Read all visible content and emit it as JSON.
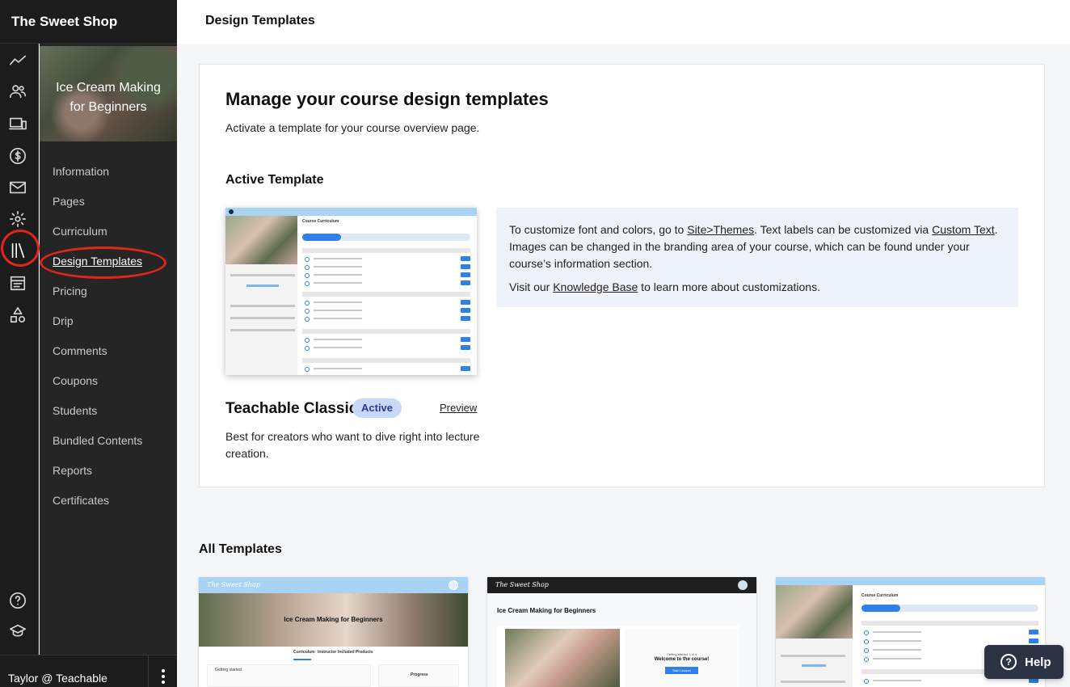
{
  "app": {
    "school_name": "The Sweet Shop",
    "page_title": "Design Templates"
  },
  "course": {
    "title": "Ice Cream Making for Beginners"
  },
  "sidebar": {
    "icons": [
      "chart-line-icon",
      "users-icon",
      "devices-icon",
      "dollar-icon",
      "mail-icon",
      "gear-icon",
      "library-icon",
      "calendar-icon",
      "shapes-icon"
    ],
    "bottom_icons": [
      "help-circle-icon",
      "graduation-cap-icon"
    ],
    "items": [
      {
        "label": "Information"
      },
      {
        "label": "Pages"
      },
      {
        "label": "Curriculum"
      },
      {
        "label": "Design Templates",
        "active": true
      },
      {
        "label": "Pricing"
      },
      {
        "label": "Drip"
      },
      {
        "label": "Comments"
      },
      {
        "label": "Coupons"
      },
      {
        "label": "Students"
      },
      {
        "label": "Bundled Contents"
      },
      {
        "label": "Reports"
      },
      {
        "label": "Certificates"
      }
    ]
  },
  "user": {
    "name": "Taylor @ Teachable"
  },
  "main": {
    "heading": "Manage your course design templates",
    "subheading": "Activate a template for your course overview page.",
    "active_section": "Active Template",
    "active_template": {
      "name": "Teachable Classic",
      "badge": "Active",
      "preview_label": "Preview",
      "description": "Best for creators who want to dive right into lecture creation."
    },
    "info": {
      "p1_a": "To customize font and colors, go to ",
      "p1_link1": "Site>Themes",
      "p1_b": ". Text labels can be customized via ",
      "p1_link2": "Custom Text",
      "p1_c": ". Images can be changed in the branding area of your course, which can be found under your course’s information section.",
      "p2_a": "Visit our ",
      "p2_link": "Knowledge Base",
      "p2_b": " to learn more about customizations."
    },
    "all_templates_heading": "All Templates"
  },
  "thumbs": {
    "curriculum": "Course Curriculum",
    "start_next": "Start next lecture",
    "shop_name": "The Sweet Shop",
    "course_title": "Ice Cream Making for Beginners",
    "tabs": [
      "Curriculum",
      "Instructor",
      "Included Products"
    ],
    "getting_started": "Getting started",
    "progress": "Progress",
    "welcome": "Welcome to the course!",
    "start_lesson": "Start Lesson",
    "getting_started_count": "Getting started 1 of 4"
  },
  "help": {
    "label": "Help"
  },
  "colors": {
    "accent": "#2f80ed",
    "highlight_ring": "#e1251b",
    "badge_bg": "#c9d8f9"
  }
}
